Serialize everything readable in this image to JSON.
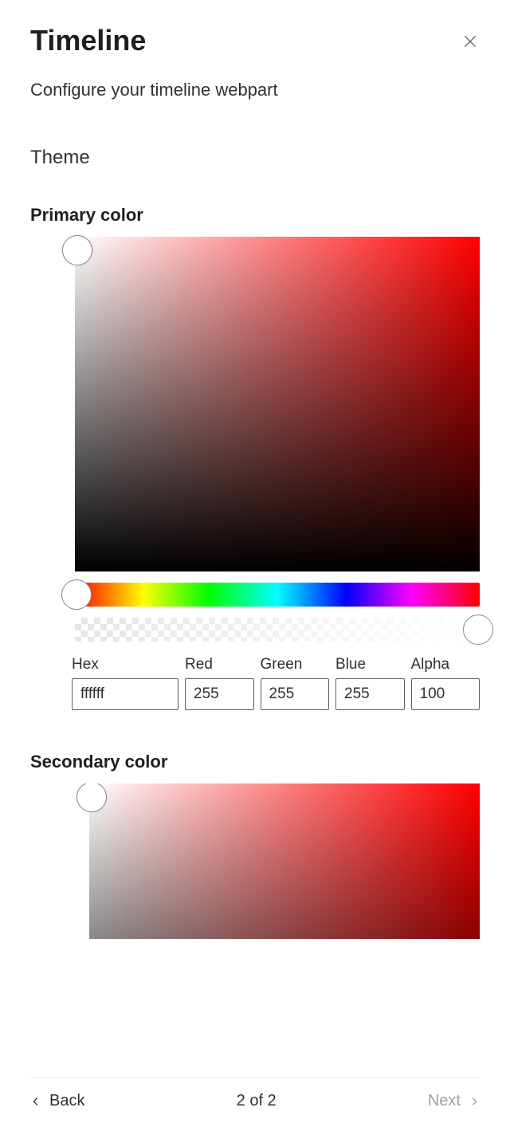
{
  "header": {
    "title": "Timeline",
    "subtitle": "Configure your timeline webpart"
  },
  "section": {
    "label": "Theme"
  },
  "primary": {
    "label": "Primary color",
    "fields": {
      "hex_label": "Hex",
      "red_label": "Red",
      "green_label": "Green",
      "blue_label": "Blue",
      "alpha_label": "Alpha",
      "hex": "ffffff",
      "red": "255",
      "green": "255",
      "blue": "255",
      "alpha": "100"
    }
  },
  "secondary": {
    "label": "Secondary color"
  },
  "footer": {
    "back": "Back",
    "page": "2 of 2",
    "next": "Next"
  }
}
